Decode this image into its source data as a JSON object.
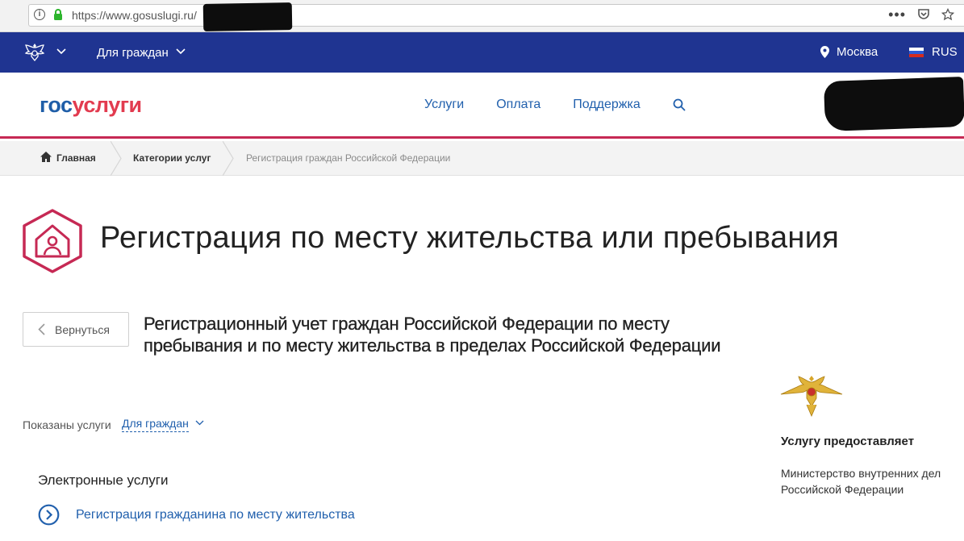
{
  "browser": {
    "url": "https://www.gosuslugi.ru/",
    "info_glyph": "i",
    "menu_glyph": "•••"
  },
  "topbar": {
    "for_citizens": "Для граждан",
    "city": "Москва",
    "language": "RUS"
  },
  "header": {
    "logo_part1": "гос",
    "logo_part2": "услуги",
    "nav": [
      "Услуги",
      "Оплата",
      "Поддержка"
    ]
  },
  "breadcrumb": {
    "home": "Главная",
    "categories": "Категории услуг",
    "current": "Регистрация граждан Российской Федерации"
  },
  "page": {
    "title": "Регистрация по месту жительства или пребывания",
    "back_label": "Вернуться",
    "service_title": "Регистрационный учет граждан Российской Федерации по месту пребывания и по месту жительства в пределах Российской Федерации",
    "shown_label": "Показаны услуги",
    "shown_value": "Для граждан",
    "e_services_heading": "Электронные услуги",
    "service_link": "Регистрация гражданина по месту жительства"
  },
  "provider": {
    "heading": "Услугу предоставляет",
    "name": "Министерство внутренних дел Российской Федерации"
  },
  "colors": {
    "topbar": "#1f3491",
    "accent": "#c62954",
    "link": "#2160ad",
    "logo_blue": "#1f5ea8",
    "logo_red": "#e23b4f"
  }
}
